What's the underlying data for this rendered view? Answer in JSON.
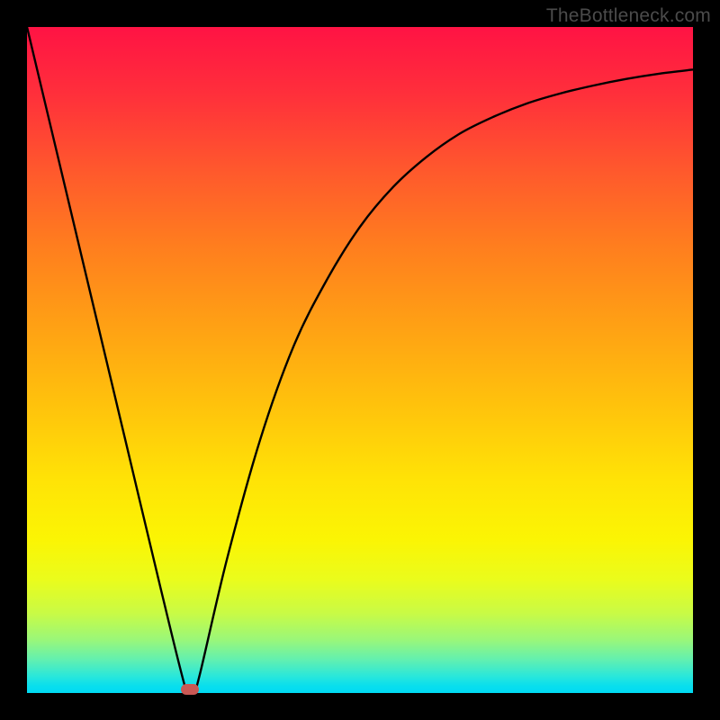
{
  "watermark": "TheBottleneck.com",
  "chart_data": {
    "type": "line",
    "title": "",
    "xlabel": "",
    "ylabel": "",
    "xlim": [
      0,
      100
    ],
    "ylim": [
      0,
      100
    ],
    "grid": false,
    "legend": false,
    "series": [
      {
        "name": "bottleneck-curve",
        "x": [
          0,
          5,
          10,
          15,
          20,
          24,
          25,
          26,
          30,
          35,
          40,
          45,
          50,
          55,
          60,
          65,
          70,
          75,
          80,
          85,
          90,
          95,
          100
        ],
        "y": [
          100,
          79,
          58,
          37,
          16,
          0,
          0,
          3,
          20,
          38,
          52,
          62,
          70,
          76,
          80.5,
          84,
          86.5,
          88.5,
          90,
          91.2,
          92.2,
          93,
          93.6
        ]
      }
    ],
    "marker": {
      "x": 24.5,
      "y": 0.6
    },
    "gradient_stops": [
      {
        "pos": 0,
        "color": "#ff1344"
      },
      {
        "pos": 0.5,
        "color": "#ffc30c"
      },
      {
        "pos": 0.8,
        "color": "#fbf504"
      },
      {
        "pos": 1.0,
        "color": "#00dbf3"
      }
    ],
    "curve_color": "#000000",
    "marker_color": "#c95854"
  }
}
